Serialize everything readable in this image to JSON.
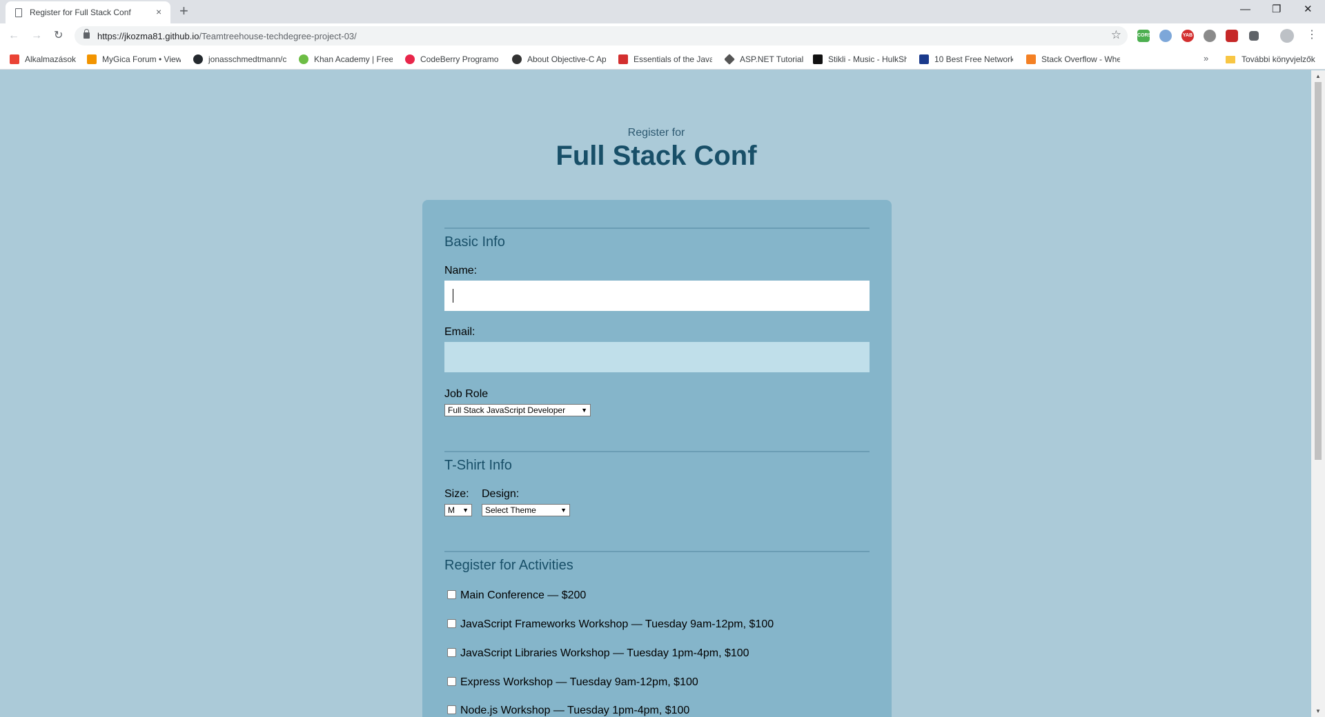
{
  "browser": {
    "tab_title": "Register for Full Stack Conf",
    "tab_close": "×",
    "new_tab": "+",
    "url_host": "https://jkozma81.github.io",
    "url_path": "/Teamtreehouse-techdegree-project-03/",
    "window_minimize": "—",
    "window_restore": "❐",
    "window_close": "✕",
    "bookmarks": [
      {
        "label": "Alkalmazások",
        "color": "#ea4335"
      },
      {
        "label": "MyGica Forum • View",
        "color": "#f29400"
      },
      {
        "label": "jonasschmedtmann/c",
        "color": "#24292e"
      },
      {
        "label": "Khan Academy | Free",
        "color": "#6dbd45"
      },
      {
        "label": "CodeBerry Programo",
        "color": "#e8264a"
      },
      {
        "label": "About Objective-C Ap",
        "color": "#333333"
      },
      {
        "label": "Essentials of the Java",
        "color": "#d32f2f"
      },
      {
        "label": "ASP.NET Tutorial",
        "color": "#555555"
      },
      {
        "label": "Stikli - Music - HulkSh",
        "color": "#111111"
      },
      {
        "label": "10 Best Free Network",
        "color": "#1a3a8c"
      },
      {
        "label": "Stack Overflow - Whe",
        "color": "#f48024"
      }
    ],
    "bookmarks_more": "»",
    "other_bookmarks": "További könyvjelzők"
  },
  "page": {
    "pre_title": "Register for",
    "title": "Full Stack Conf"
  },
  "form": {
    "basic_info_legend": "Basic Info",
    "name_label": "Name:",
    "name_value": "",
    "email_label": "Email:",
    "email_value": "",
    "job_role_label": "Job Role",
    "job_role_selected": "Full Stack JavaScript Developer",
    "tshirt_legend": "T-Shirt Info",
    "size_label": "Size:",
    "size_selected": "M",
    "design_label": "Design:",
    "design_selected": "Select Theme",
    "activities_legend": "Register for Activities",
    "activities": [
      {
        "label": "Main Conference — $200",
        "checked": false
      },
      {
        "label": "JavaScript Frameworks Workshop — Tuesday 9am-12pm, $100",
        "checked": false
      },
      {
        "label": "JavaScript Libraries Workshop — Tuesday 1pm-4pm, $100",
        "checked": false
      },
      {
        "label": "Express Workshop — Tuesday 9am-12pm, $100",
        "checked": false
      },
      {
        "label": "Node.js Workshop — Tuesday 1pm-4pm, $100",
        "checked": false
      }
    ]
  }
}
